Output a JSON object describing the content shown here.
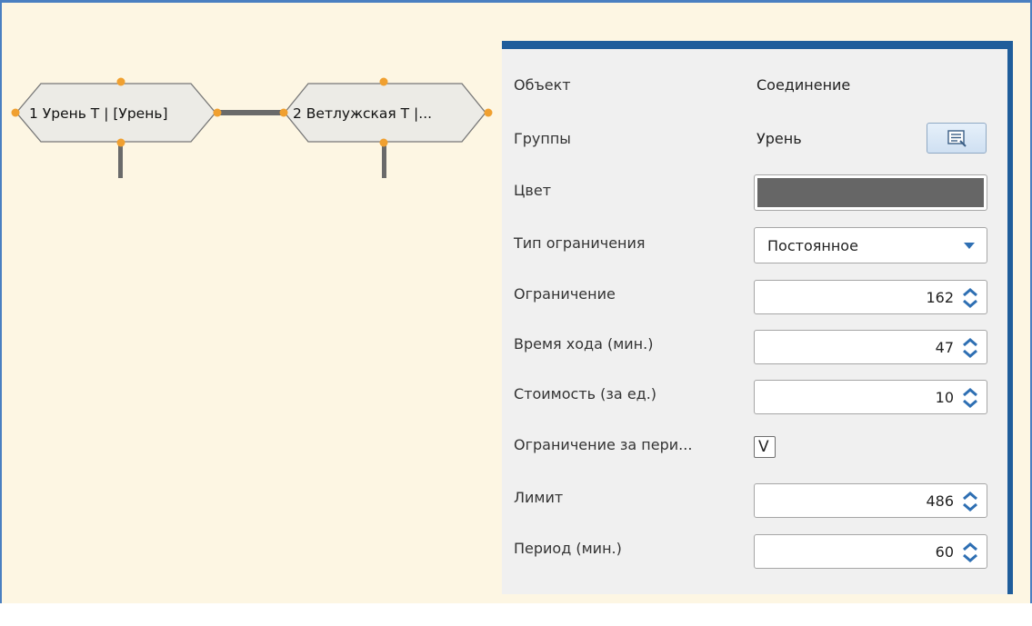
{
  "colors": {
    "canvas_bg": "#fdf6e3",
    "panel_border": "#1f5d9b",
    "port": "#f0a030",
    "connection_color": "#666666"
  },
  "diagram": {
    "nodes": [
      {
        "id": 1,
        "label": "1 Урень Т | [Урень]"
      },
      {
        "id": 2,
        "label": "2 Ветлужская Т |..."
      }
    ]
  },
  "properties": {
    "object": {
      "label": "Объект",
      "value": "Соединение"
    },
    "groups": {
      "label": "Группы",
      "value": "Урень",
      "button_icon": "list-edit-icon"
    },
    "color": {
      "label": "Цвет",
      "value": "#666666"
    },
    "limit_type": {
      "label": "Тип ограничения",
      "value": "Постоянное"
    },
    "limit": {
      "label": "Ограничение",
      "value": "162"
    },
    "travel_time": {
      "label": "Время хода (мин.)",
      "value": "47"
    },
    "cost": {
      "label": "Стоимость (за ед.)",
      "value": "10"
    },
    "period_limit": {
      "label": "Ограничение за пери...",
      "checked": true,
      "mark": "V"
    },
    "quota": {
      "label": "Лимит",
      "value": "486"
    },
    "period": {
      "label": "Период (мин.)",
      "value": "60"
    }
  }
}
